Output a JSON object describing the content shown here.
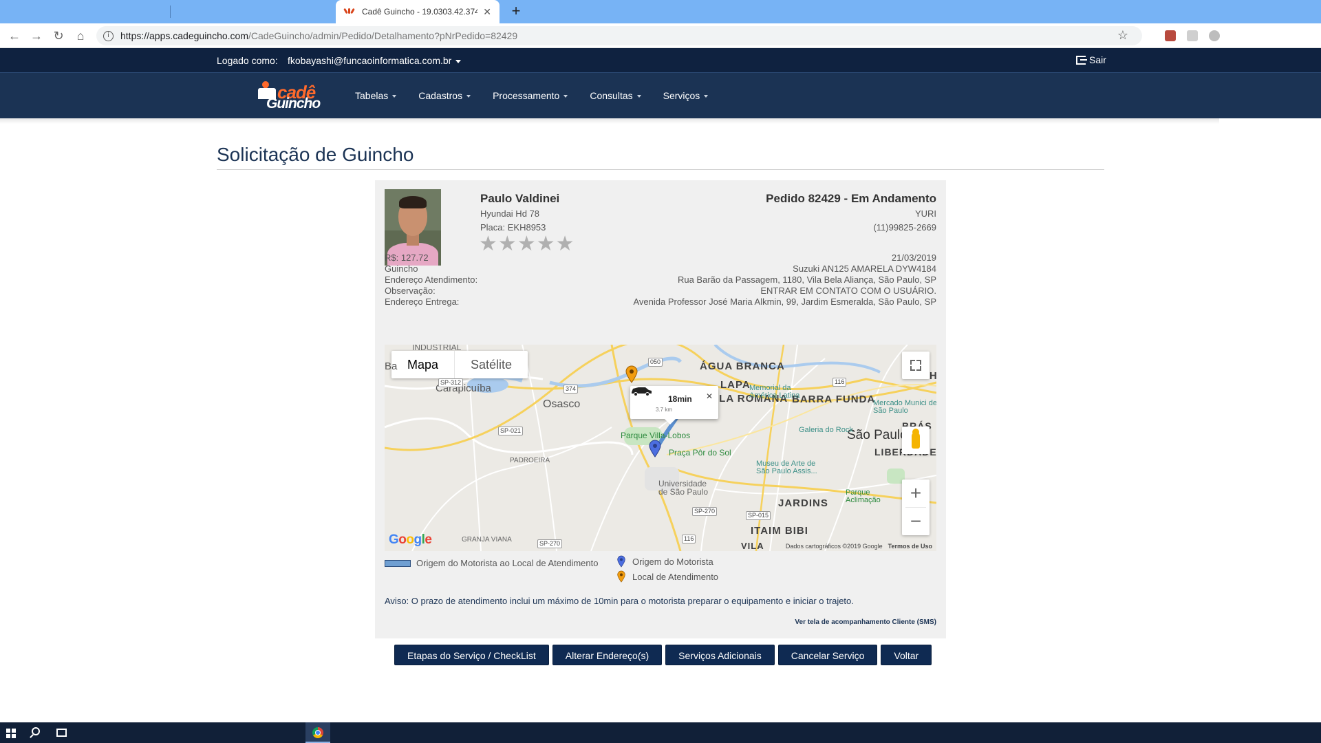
{
  "browser": {
    "tab_title": "Cadê Guincho - 19.0303.42.3747",
    "url_host": "https://apps.cadeguincho.com",
    "url_path": "/CadeGuincho/admin/Pedido/Detalhamento?pNrPedido=82429"
  },
  "topbar": {
    "login_label": "Logado como:",
    "user_email": "fkobayashi@funcaoinformatica.com.br",
    "logout_label": "Sair"
  },
  "logo": {
    "word1": "cadê",
    "word2": "Guincho"
  },
  "nav": [
    "Tabelas",
    "Cadastros",
    "Processamento",
    "Consultas",
    "Serviços"
  ],
  "page_title": "Solicitação de Guincho",
  "driver": {
    "name": "Paulo Valdinei",
    "vehicle": "Hyundai Hd 78",
    "plate": "Placa: EKH8953",
    "rating": 0,
    "rating_max": 5
  },
  "order": {
    "title": "Pedido 82429 - Em Andamento",
    "client": "YURI",
    "phone": "(11)99825-2669"
  },
  "details": {
    "price": "R$: 127.72",
    "date": "21/03/2019",
    "service": "Guincho",
    "vehicle": "Suzuki AN125 AMARELA DYW4184",
    "address_label": "Endereço Atendimento:",
    "address": "Rua Barão da Passagem, 1180, Vila Bela Aliança, São Paulo, SP",
    "obs_label": "Observação:",
    "obs": "ENTRAR EM CONTATO COM O USUÁRIO.",
    "delivery_label": "Endereço Entrega:",
    "delivery": "Avenida Professor José Maria Alkmin, 99, Jardim Esmeralda, São Paulo, SP"
  },
  "map": {
    "tab_map": "Mapa",
    "tab_satellite": "Satélite",
    "route_time": "18min",
    "route_distance": "3.7 km",
    "labels": {
      "carapicuiba": "Carapicuíba",
      "osasco": "Osasco",
      "agua_branca": "ÁGUA BRANCA",
      "lapa": "LAPA",
      "vila_romana": "ILA ROMANA",
      "barra_funda": "BARRA FUNDA",
      "guilhe": "GUILHE",
      "sao_paulo": "São Paulo",
      "liberdade": "LIBERDADE",
      "jardins": "JARDINS",
      "itaim": "ITAIM BIBI",
      "vila": "VILA",
      "padroeira": "PADROEIRA",
      "granja": "GRANJA VIANA",
      "industrial": "INDUSTRIAL",
      "parque_vl": "Parque Villa-Lobos",
      "praca": "Praça Pôr do Sol",
      "usp": "Universidade de São Paulo",
      "memorial": "Memorial da América Latina",
      "mercado": "Mercado Munici de São Paulo",
      "galeria": "Galeria do Rock",
      "bras": "BRÁS",
      "museu": "Museu de Arte de São Paulo Assis...",
      "aclimacao": "Parque Aclimação",
      "ba": "Ba"
    },
    "shields": [
      "SP-312",
      "374",
      "050",
      "116",
      "SP-021",
      "SP-270",
      "SP-015",
      "116",
      "SP-270"
    ],
    "credits": "Dados cartográficos ©2019 Google",
    "terms": "Termos de Uso",
    "google": "Google"
  },
  "legend": {
    "route": "Origem do Motorista ao Local de Atendimento",
    "driver_origin": "Origem do Motorista",
    "service_location": "Local de Atendimento"
  },
  "notice": "Aviso: O prazo de atendimento inclui um máximo de 10min para o motorista preparar o equipamento e iniciar o trajeto.",
  "sms_link": "Ver tela de acompanhamento Cliente (SMS)",
  "actions": [
    "Etapas do Serviço / CheckList",
    "Alterar Endereço(s)",
    "Serviços Adicionais",
    "Cancelar Serviço",
    "Voltar"
  ],
  "colors": {
    "navbar": "#1b3354",
    "topbar": "#0f2240",
    "button": "#0f2a52",
    "accent_orange": "#ff6a2c",
    "pin_blue": "#4c6ee0",
    "pin_orange": "#f29d0f",
    "route_line": "#6f9fd2"
  }
}
